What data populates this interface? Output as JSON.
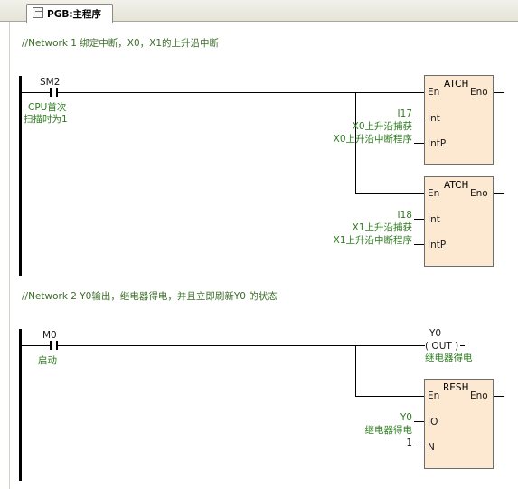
{
  "tab": {
    "label": "PGB:主程序"
  },
  "network1": {
    "comment": "//Network 1  绑定中断，X0，X1的上升沿中断",
    "contact": {
      "name": "SM2",
      "desc_line1": "CPU首次",
      "desc_line2": "扫描时为1"
    },
    "block1": {
      "title": "ATCH",
      "en": "En",
      "eno": "Eno",
      "pin_int": "Int",
      "pin_intp": "IntP",
      "int_value": "I17",
      "int_desc": "X0上升沿捕获",
      "intp_value": "X0上升沿中断程序"
    },
    "block2": {
      "title": "ATCH",
      "en": "En",
      "eno": "Eno",
      "pin_int": "Int",
      "pin_intp": "IntP",
      "int_value": "I18",
      "int_desc": "X1上升沿捕获",
      "intp_value": "X1上升沿中断程序"
    }
  },
  "network2": {
    "comment": "//Network 2  Y0输出，继电器得电，并且立即刷新Y0 的状态",
    "contact": {
      "name": "M0",
      "desc": "启动"
    },
    "coil": {
      "name": "Y0",
      "symbol": "( OUT )",
      "desc": "继电器得电"
    },
    "block": {
      "title": "RESH",
      "en": "En",
      "eno": "Eno",
      "pin_io": "IO",
      "pin_n": "N",
      "io_value": "Y0",
      "io_desc": "继电器得电",
      "n_value": "1"
    }
  }
}
